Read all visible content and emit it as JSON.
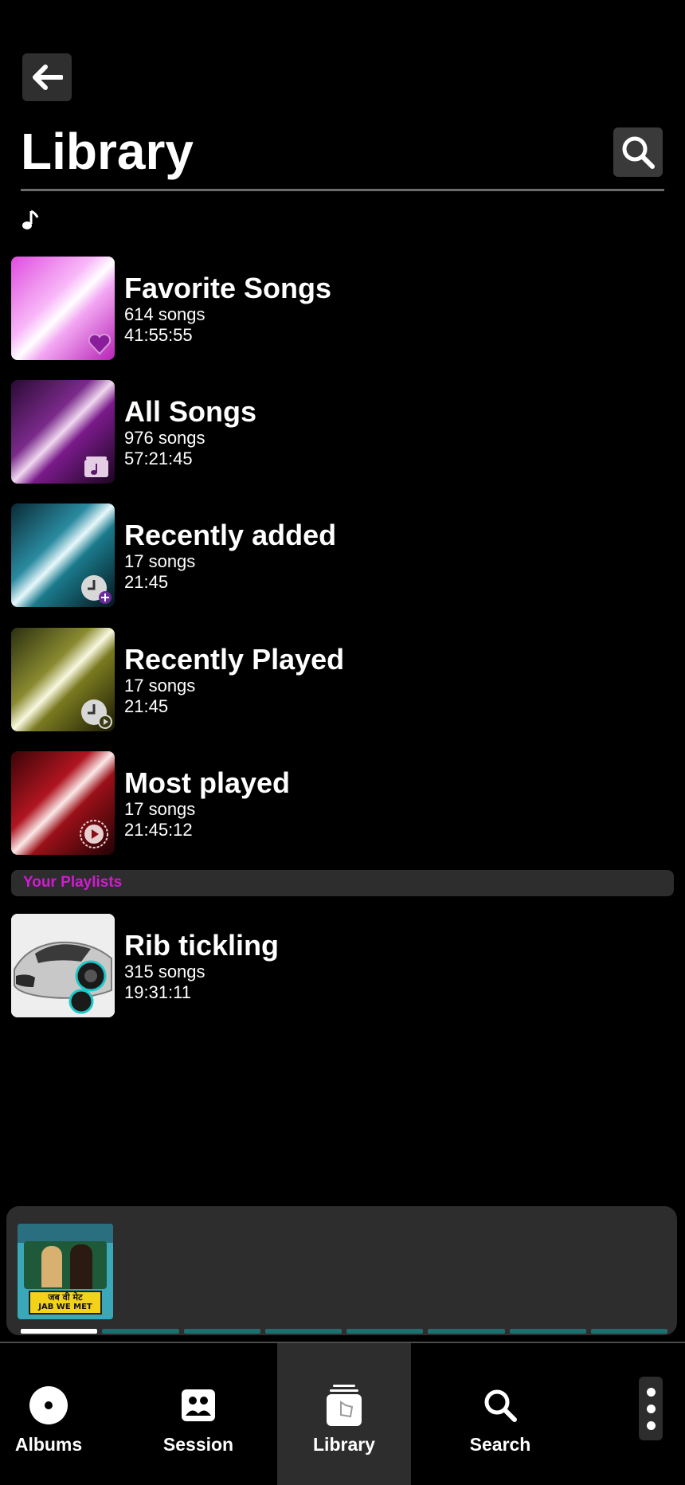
{
  "header": {
    "title": "Library"
  },
  "lists": [
    {
      "title": "Favorite Songs",
      "count": "614 songs",
      "duration": "41:55:55",
      "color": "#e04ce0",
      "icon": "heart-icon"
    },
    {
      "title": "All Songs",
      "count": "976 songs",
      "duration": "57:21:45",
      "color": "#5a1a6a",
      "icon": "music-folder-icon"
    },
    {
      "title": "Recently added",
      "count": "17 songs",
      "duration": "21:45",
      "color": "#1b6b7a",
      "icon": "clock-plus-icon"
    },
    {
      "title": "Recently Played",
      "count": "17 songs",
      "duration": "21:45",
      "color": "#6b6b1a",
      "icon": "clock-play-icon"
    },
    {
      "title": "Most played",
      "count": "17 songs",
      "duration": "21:45:12",
      "color": "#8a0f15",
      "icon": "play-circle-icon"
    }
  ],
  "section": {
    "label": "Your Playlists",
    "color": "#d21bd2"
  },
  "playlists": [
    {
      "title": "Rib tickling",
      "count": "315 songs",
      "duration": "19:31:11",
      "icon": "car-artwork"
    }
  ],
  "mini_player": {
    "artwork": "album-art-jab-we-met",
    "art_text_hindi": "जब वी मेट",
    "art_text": "JAB WE MET",
    "segments_done": 1,
    "segments_total": 8
  },
  "nav": {
    "items": [
      {
        "label": "Albums",
        "icon": "album-disc-icon"
      },
      {
        "label": "Session",
        "icon": "people-icon"
      },
      {
        "label": "Library",
        "icon": "library-stack-icon",
        "active": true
      },
      {
        "label": "Search",
        "icon": "search-icon"
      }
    ]
  }
}
